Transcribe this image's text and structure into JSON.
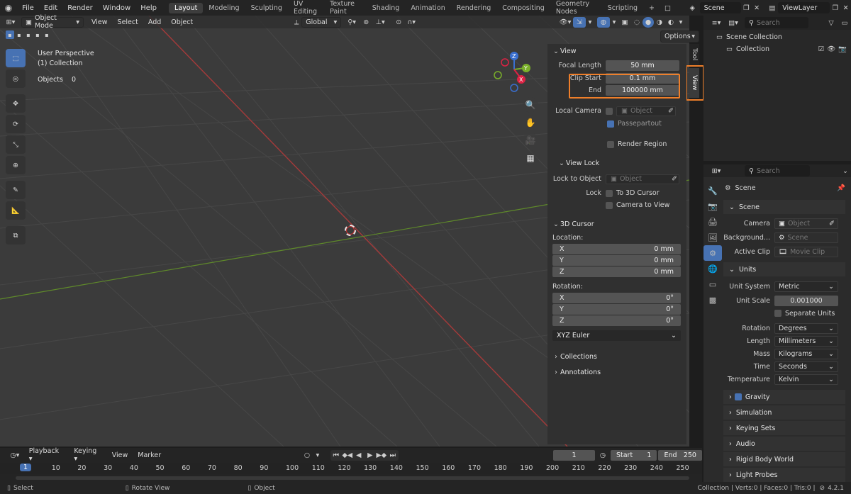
{
  "topbar": {
    "menus": [
      "File",
      "Edit",
      "Render",
      "Window",
      "Help"
    ],
    "workspaces": [
      "Layout",
      "Modeling",
      "Sculpting",
      "UV Editing",
      "Texture Paint",
      "Shading",
      "Animation",
      "Rendering",
      "Compositing",
      "Geometry Nodes",
      "Scripting"
    ],
    "active_workspace": "Layout",
    "add_workspace": "+",
    "scene": "Scene",
    "view_layer": "ViewLayer"
  },
  "viewport_header": {
    "mode": "Object Mode",
    "menus": [
      "View",
      "Select",
      "Add",
      "Object"
    ],
    "orientation": "Global",
    "options": "Options"
  },
  "overlay": {
    "perspective": "User Perspective",
    "collection": "(1) Collection",
    "objects_label": "Objects",
    "objects_count": "0"
  },
  "gizmo": {
    "z": "Z",
    "y": "Y",
    "x": "X"
  },
  "npanel": {
    "tabs": [
      "Tool",
      "View"
    ],
    "view": {
      "title": "View",
      "focal_length_label": "Focal Length",
      "focal_length": "50 mm",
      "clip_start_label": "Clip Start",
      "clip_start": "0.1 mm",
      "end_label": "End",
      "end": "100000 mm",
      "local_camera_label": "Local Camera",
      "local_camera_placeholder": "Object",
      "passepartout": "Passepartout",
      "render_region": "Render Region"
    },
    "view_lock": {
      "title": "View Lock",
      "lock_to_object_label": "Lock to Object",
      "lock_to_object_placeholder": "Object",
      "lock_label": "Lock",
      "to_3d_cursor": "To 3D Cursor",
      "camera_to_view": "Camera to View"
    },
    "cursor": {
      "title": "3D Cursor",
      "location_label": "Location:",
      "loc": [
        {
          "axis": "X",
          "value": "0 mm"
        },
        {
          "axis": "Y",
          "value": "0 mm"
        },
        {
          "axis": "Z",
          "value": "0 mm"
        }
      ],
      "rotation_label": "Rotation:",
      "rot": [
        {
          "axis": "X",
          "value": "0°"
        },
        {
          "axis": "Y",
          "value": "0°"
        },
        {
          "axis": "Z",
          "value": "0°"
        }
      ],
      "rotation_mode": "XYZ Euler"
    },
    "collections": "Collections",
    "annotations": "Annotations"
  },
  "outliner": {
    "search_placeholder": "Search",
    "scene_collection": "Scene Collection",
    "collection": "Collection"
  },
  "properties": {
    "search_placeholder": "Search",
    "context": "Scene",
    "scene_section": "Scene",
    "camera_label": "Camera",
    "camera_placeholder": "Object",
    "background_label": "Background...",
    "background_placeholder": "Scene",
    "active_clip_label": "Active Clip",
    "active_clip_placeholder": "Movie Clip",
    "units_section": "Units",
    "unit_system_label": "Unit System",
    "unit_system": "Metric",
    "unit_scale_label": "Unit Scale",
    "unit_scale": "0.001000",
    "separate_units": "Separate Units",
    "rotation_label": "Rotation",
    "rotation": "Degrees",
    "length_label": "Length",
    "length": "Millimeters",
    "mass_label": "Mass",
    "mass": "Kilograms",
    "time_label": "Time",
    "time": "Seconds",
    "temperature_label": "Temperature",
    "temperature": "Kelvin",
    "gravity": "Gravity",
    "simulation": "Simulation",
    "keying_sets": "Keying Sets",
    "audio": "Audio",
    "rigid_body_world": "Rigid Body World",
    "light_probes": "Light Probes"
  },
  "timeline": {
    "menus": [
      "Playback",
      "Keying",
      "View",
      "Marker"
    ],
    "current_frame": "1",
    "start_label": "Start",
    "start": "1",
    "end_label": "End",
    "end": "250",
    "ruler": [
      "1",
      "10",
      "20",
      "30",
      "40",
      "50",
      "60",
      "70",
      "80",
      "90",
      "100",
      "110",
      "120",
      "130",
      "140",
      "150",
      "160",
      "170",
      "180",
      "190",
      "200",
      "210",
      "220",
      "230",
      "240",
      "250"
    ]
  },
  "statusbar": {
    "select": "Select",
    "rotate_view": "Rotate View",
    "object": "Object",
    "stats": "Collection | Verts:0 | Faces:0 | Tris:0 |",
    "version": "4.2.1"
  },
  "colors": {
    "accent": "#4772b3",
    "highlight": "#ef7f2a",
    "x_axis": "#c23a3a",
    "y_axis": "#6a9a2a"
  }
}
